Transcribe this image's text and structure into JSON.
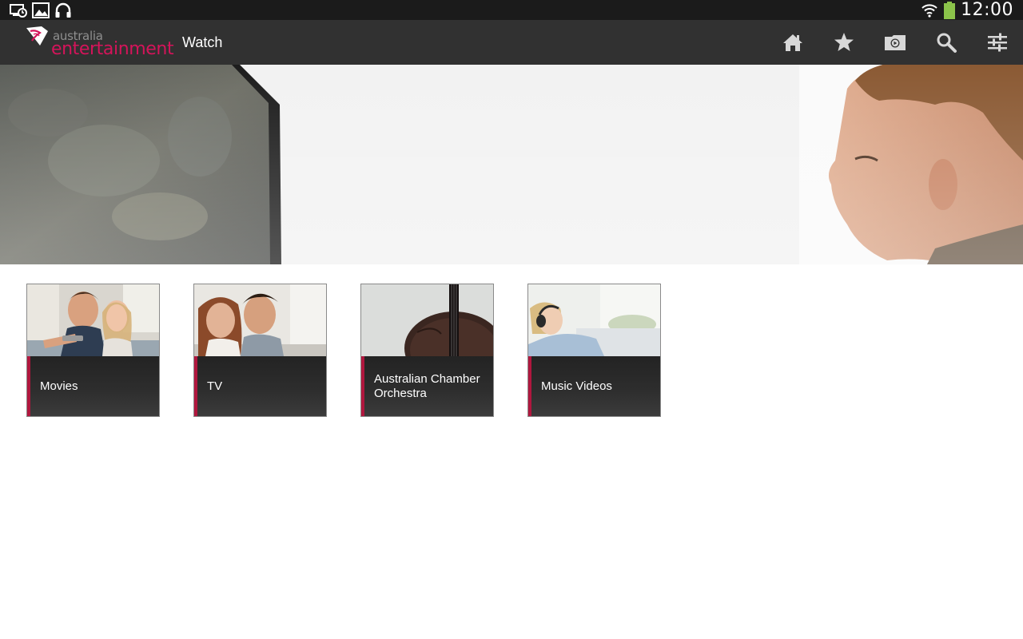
{
  "status_bar": {
    "left_icons": [
      "screen-timer-icon",
      "gallery-icon",
      "headphones-icon"
    ],
    "right_icons": [
      "wifi-icon",
      "battery-icon"
    ],
    "clock": "12:00",
    "battery_color": "#8bc34a"
  },
  "action_bar": {
    "logo": {
      "small_text": "australia",
      "big_text": "entertainment",
      "brand_color": "#d4145a"
    },
    "title": "Watch",
    "actions": [
      {
        "name": "home-icon"
      },
      {
        "name": "star-icon"
      },
      {
        "name": "video-folder-icon"
      },
      {
        "name": "search-icon"
      },
      {
        "name": "settings-sliders-icon"
      }
    ]
  },
  "categories": [
    {
      "label": "Movies",
      "image": "couple-with-remote"
    },
    {
      "label": "TV",
      "image": "couple-watching"
    },
    {
      "label": "Australian Chamber Orchestra",
      "image": "cello"
    },
    {
      "label": "Music Videos",
      "image": "woman-with-headphones"
    }
  ],
  "accent_color": "#b0173e"
}
